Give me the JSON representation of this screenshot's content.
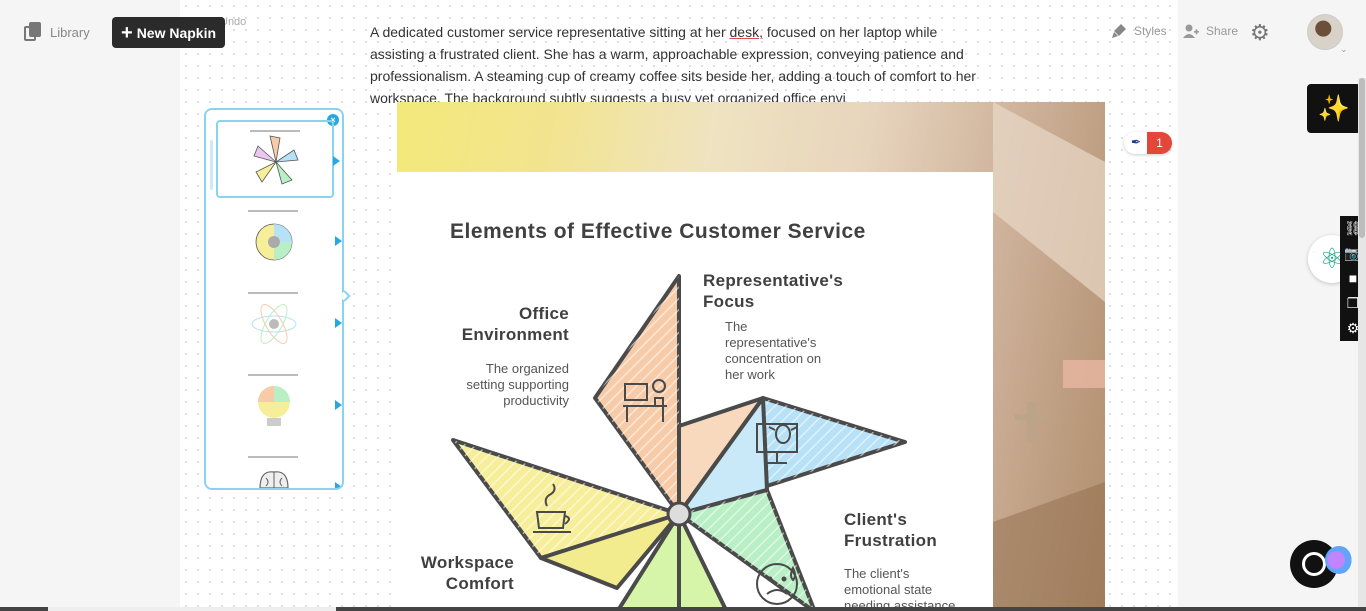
{
  "topbar": {
    "library_label": "Library",
    "new_napkin_label": "New Napkin",
    "undo_label": "Undo",
    "styles_label": "Styles",
    "share_label": "Share"
  },
  "document": {
    "text_before": "A dedicated customer service representative sitting at her ",
    "text_err": "desk,",
    "text_after": " focused on her laptop while assisting a frustrated client. She has a warm, approachable expression, conveying patience and professionalism. A steaming cup of creamy coffee sits beside her, adding a touch of comfort to her workspace. The background subtly suggests a busy yet organized office envi"
  },
  "infographic": {
    "title": "Elements of Effective Customer Service",
    "segments": [
      {
        "head1": "Office",
        "head2": "Environment",
        "desc": [
          "The organized",
          "setting supporting",
          "productivity"
        ],
        "color": "#f7cba8",
        "icon": "desk-clock-icon"
      },
      {
        "head1": "Representative's",
        "head2": "Focus",
        "desc": [
          "The",
          "representative's",
          "concentration on",
          "her work"
        ],
        "color": "#b7e1f6",
        "icon": "monitor-bug-icon"
      },
      {
        "head1": "Client's",
        "head2": "Frustration",
        "desc": [
          "The client's",
          "emotional state",
          "needing assistance"
        ],
        "color": "#b9efc4",
        "icon": "sad-face-icon"
      },
      {
        "head1": "Workspace",
        "head2": "Comfort",
        "desc": [],
        "color": "#f7ee9a",
        "icon": "coffee-cup-icon"
      }
    ]
  },
  "comments": {
    "count": "1"
  },
  "colors": {
    "accent": "#29a8e0",
    "badge": "#e5463a",
    "dark": "#2b2b2b"
  }
}
